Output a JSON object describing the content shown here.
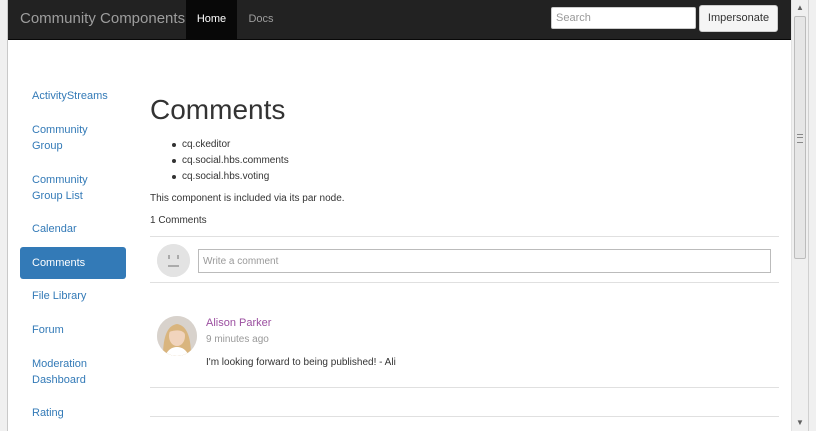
{
  "navbar": {
    "brand": "Community Components",
    "tabs": [
      {
        "label": "Home",
        "active": true
      },
      {
        "label": "Docs",
        "active": false
      }
    ],
    "search_placeholder": "Search",
    "impersonate_label": "Impersonate"
  },
  "sidebar": {
    "items": [
      {
        "label": "ActivityStreams"
      },
      {
        "label": "Community Group"
      },
      {
        "label": "Community Group List"
      },
      {
        "label": "Calendar"
      },
      {
        "label": "Comments",
        "active": true
      },
      {
        "label": "File Library"
      },
      {
        "label": "Forum"
      },
      {
        "label": "Moderation Dashboard"
      },
      {
        "label": "Rating"
      }
    ]
  },
  "main": {
    "title": "Comments",
    "dependencies": [
      "cq.ckeditor",
      "cq.social.hbs.comments",
      "cq.social.hbs.voting"
    ],
    "note": "This component is included via its par node.",
    "count_text": "1 Comments",
    "comment_placeholder": "Write a comment",
    "comments": [
      {
        "author": "Alison Parker",
        "time": "9 minutes ago",
        "text": "I'm looking forward to being published! - Ali"
      }
    ]
  },
  "colors": {
    "navbar_bg": "#222222",
    "link": "#337ab7",
    "author": "#9b4fa0"
  }
}
